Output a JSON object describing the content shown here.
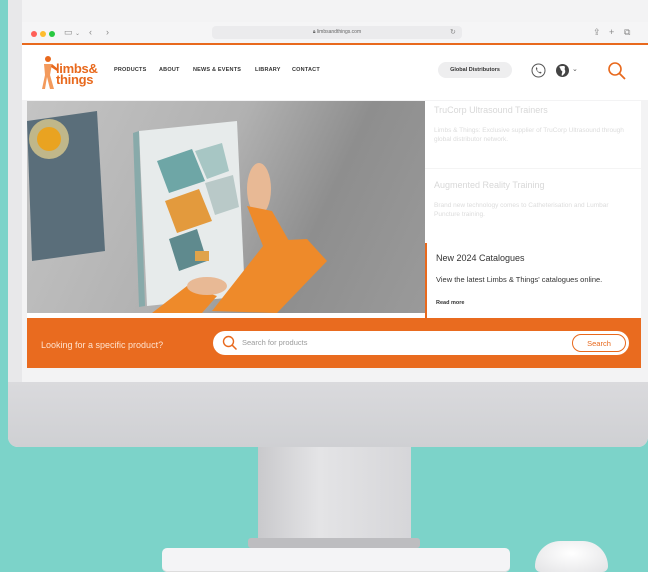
{
  "browser": {
    "url": "limbsandthings.com"
  },
  "site": {
    "logo_line1": "limbs&",
    "logo_line2": "things",
    "nav": [
      "PRODUCTS",
      "ABOUT",
      "NEWS & EVENTS",
      "LIBRARY",
      "CONTACT"
    ],
    "distributors_label": "Global Distributors"
  },
  "panels": [
    {
      "title": "TruCorp Ultrasound Trainers",
      "description": "Limbs & Things: Exclusive supplier of TruCorp Ultrasound through global distributor network."
    },
    {
      "title": "Augmented Reality Training",
      "description": "Brand new technology comes to Catheterisation and Lumbar Puncture training."
    },
    {
      "title": "New 2024 Catalogues",
      "description": "View the latest Limbs & Things' catalogues online.",
      "link": "Read more"
    }
  ],
  "search": {
    "prompt": "Looking for a specific product?",
    "placeholder": "Search for products",
    "button": "Search"
  },
  "colors": {
    "accent": "#e8691d",
    "background": "#7cd3c9"
  },
  "icons": [
    "shield-icon",
    "search-icon",
    "phone-icon",
    "globe-icon",
    "chevron-down-icon",
    "share-icon",
    "plus-icon",
    "tabs-icon",
    "reload-icon",
    "sidebar-icon",
    "back-icon",
    "forward-icon"
  ]
}
